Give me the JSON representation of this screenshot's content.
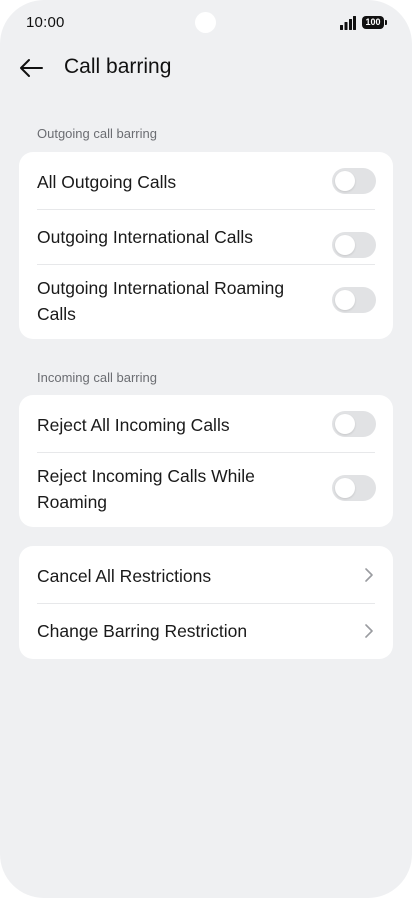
{
  "status_bar": {
    "time": "10:00",
    "battery_level": "100",
    "icons": [
      "camera-cutout",
      "signal-icon",
      "battery-icon"
    ]
  },
  "header": {
    "back_icon": "arrow-left-icon",
    "title": "Call barring"
  },
  "sections": {
    "outgoing": {
      "label": "Outgoing call barring",
      "items": [
        {
          "label": "All Outgoing Calls",
          "enabled": false
        },
        {
          "label": "Outgoing International Calls",
          "enabled": false
        },
        {
          "label": "Outgoing International Roaming Calls",
          "enabled": false
        }
      ]
    },
    "incoming": {
      "label": "Incoming call barring",
      "items": [
        {
          "label": "Reject All Incoming Calls",
          "enabled": false
        },
        {
          "label": "Reject Incoming Calls While Roaming",
          "enabled": false
        }
      ]
    },
    "actions": {
      "items": [
        {
          "label": "Cancel All Restrictions",
          "icon": "chevron-right-icon"
        },
        {
          "label": "Change Barring Restriction",
          "icon": "chevron-right-icon"
        }
      ]
    }
  },
  "colors": {
    "background": "#eff0f2",
    "card": "#ffffff",
    "toggle_off": "#e1e2e4",
    "text_primary": "#1a1a1a",
    "text_secondary": "#6b6d72"
  }
}
